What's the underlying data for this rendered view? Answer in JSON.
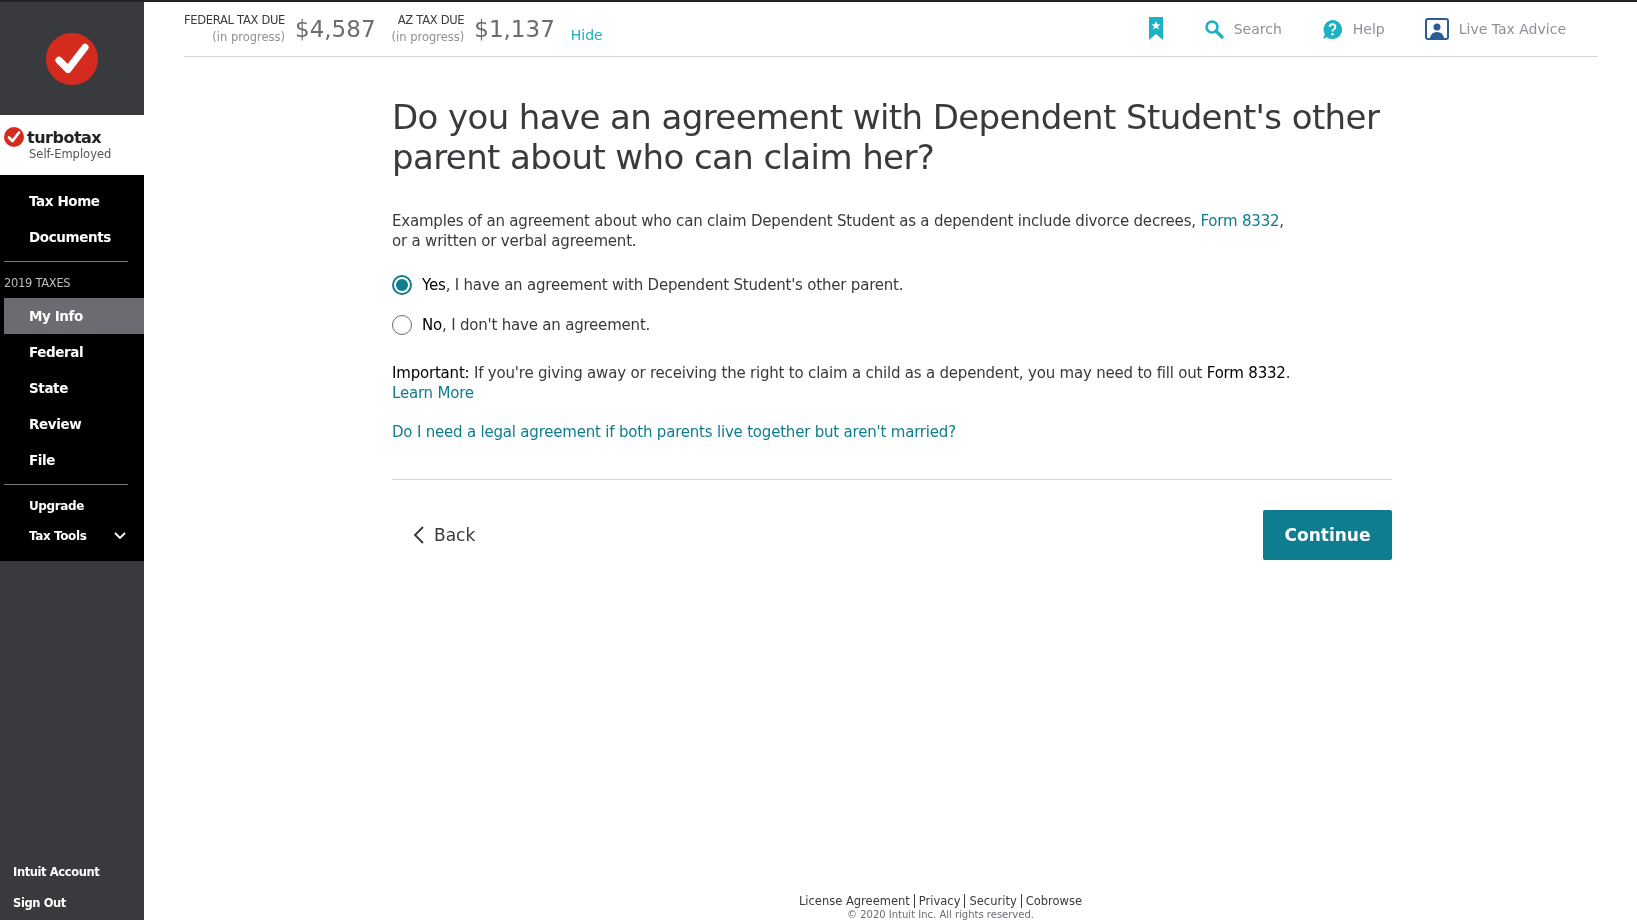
{
  "sidebar": {
    "brand": {
      "name": "turbotax",
      "edition": "Self-Employed"
    },
    "top_items": [
      {
        "label": "Tax Home",
        "selected": false
      },
      {
        "label": "Documents",
        "selected": false
      }
    ],
    "section_label": "2019 TAXES",
    "steps": [
      {
        "label": "My Info",
        "selected": true
      },
      {
        "label": "Federal",
        "selected": false
      },
      {
        "label": "State",
        "selected": false
      },
      {
        "label": "Review",
        "selected": false
      },
      {
        "label": "File",
        "selected": false
      }
    ],
    "extra_items": [
      {
        "label": "Upgrade",
        "kind": "link"
      },
      {
        "label": "Tax Tools",
        "kind": "dropdown",
        "expanded": false
      }
    ],
    "account_items": [
      {
        "label": "Intuit Account"
      },
      {
        "label": "Sign Out"
      }
    ]
  },
  "header": {
    "taxes": [
      {
        "label": "FEDERAL TAX DUE",
        "note": "(in progress)",
        "amount": "$4,587"
      },
      {
        "label": "AZ TAX DUE",
        "note": "(in progress)",
        "amount": "$1,137"
      }
    ],
    "hide_link": "Hide",
    "actions": [
      {
        "kind": "bookmark"
      },
      {
        "kind": "search",
        "label": "Search"
      },
      {
        "kind": "help",
        "label": "Help"
      },
      {
        "kind": "advice",
        "label": "Live Tax Advice"
      }
    ]
  },
  "question": {
    "title": "Do you have an agreement with Dependent Student's other parent about who can claim her?",
    "intro": {
      "before": "Examples of an agreement about who can claim Dependent Student as a dependent include divorce decrees, ",
      "link": "Form 8332",
      "after": ", or a written or verbal agreement."
    },
    "options": [
      {
        "label": "**Yes**, I have an agreement with Dependent Student's other parent.",
        "selected": true
      },
      {
        "label": "**No**, I don't have an agreement.",
        "selected": false
      }
    ],
    "important": {
      "text": "**Important:** If you're giving away or receiving the right to claim a child as a dependent, you may need to fill out **Form 8332**.",
      "link": "Learn More"
    },
    "help_link": "Do I need a legal agreement if both parents live together but aren't married?"
  },
  "nav": {
    "back": "Back",
    "continue": "Continue"
  },
  "footer": {
    "links": [
      "License Agreement",
      "Privacy",
      "Security",
      "Cobrowse"
    ],
    "copyright": "© 2020 Intuit Inc. All rights reserved."
  }
}
